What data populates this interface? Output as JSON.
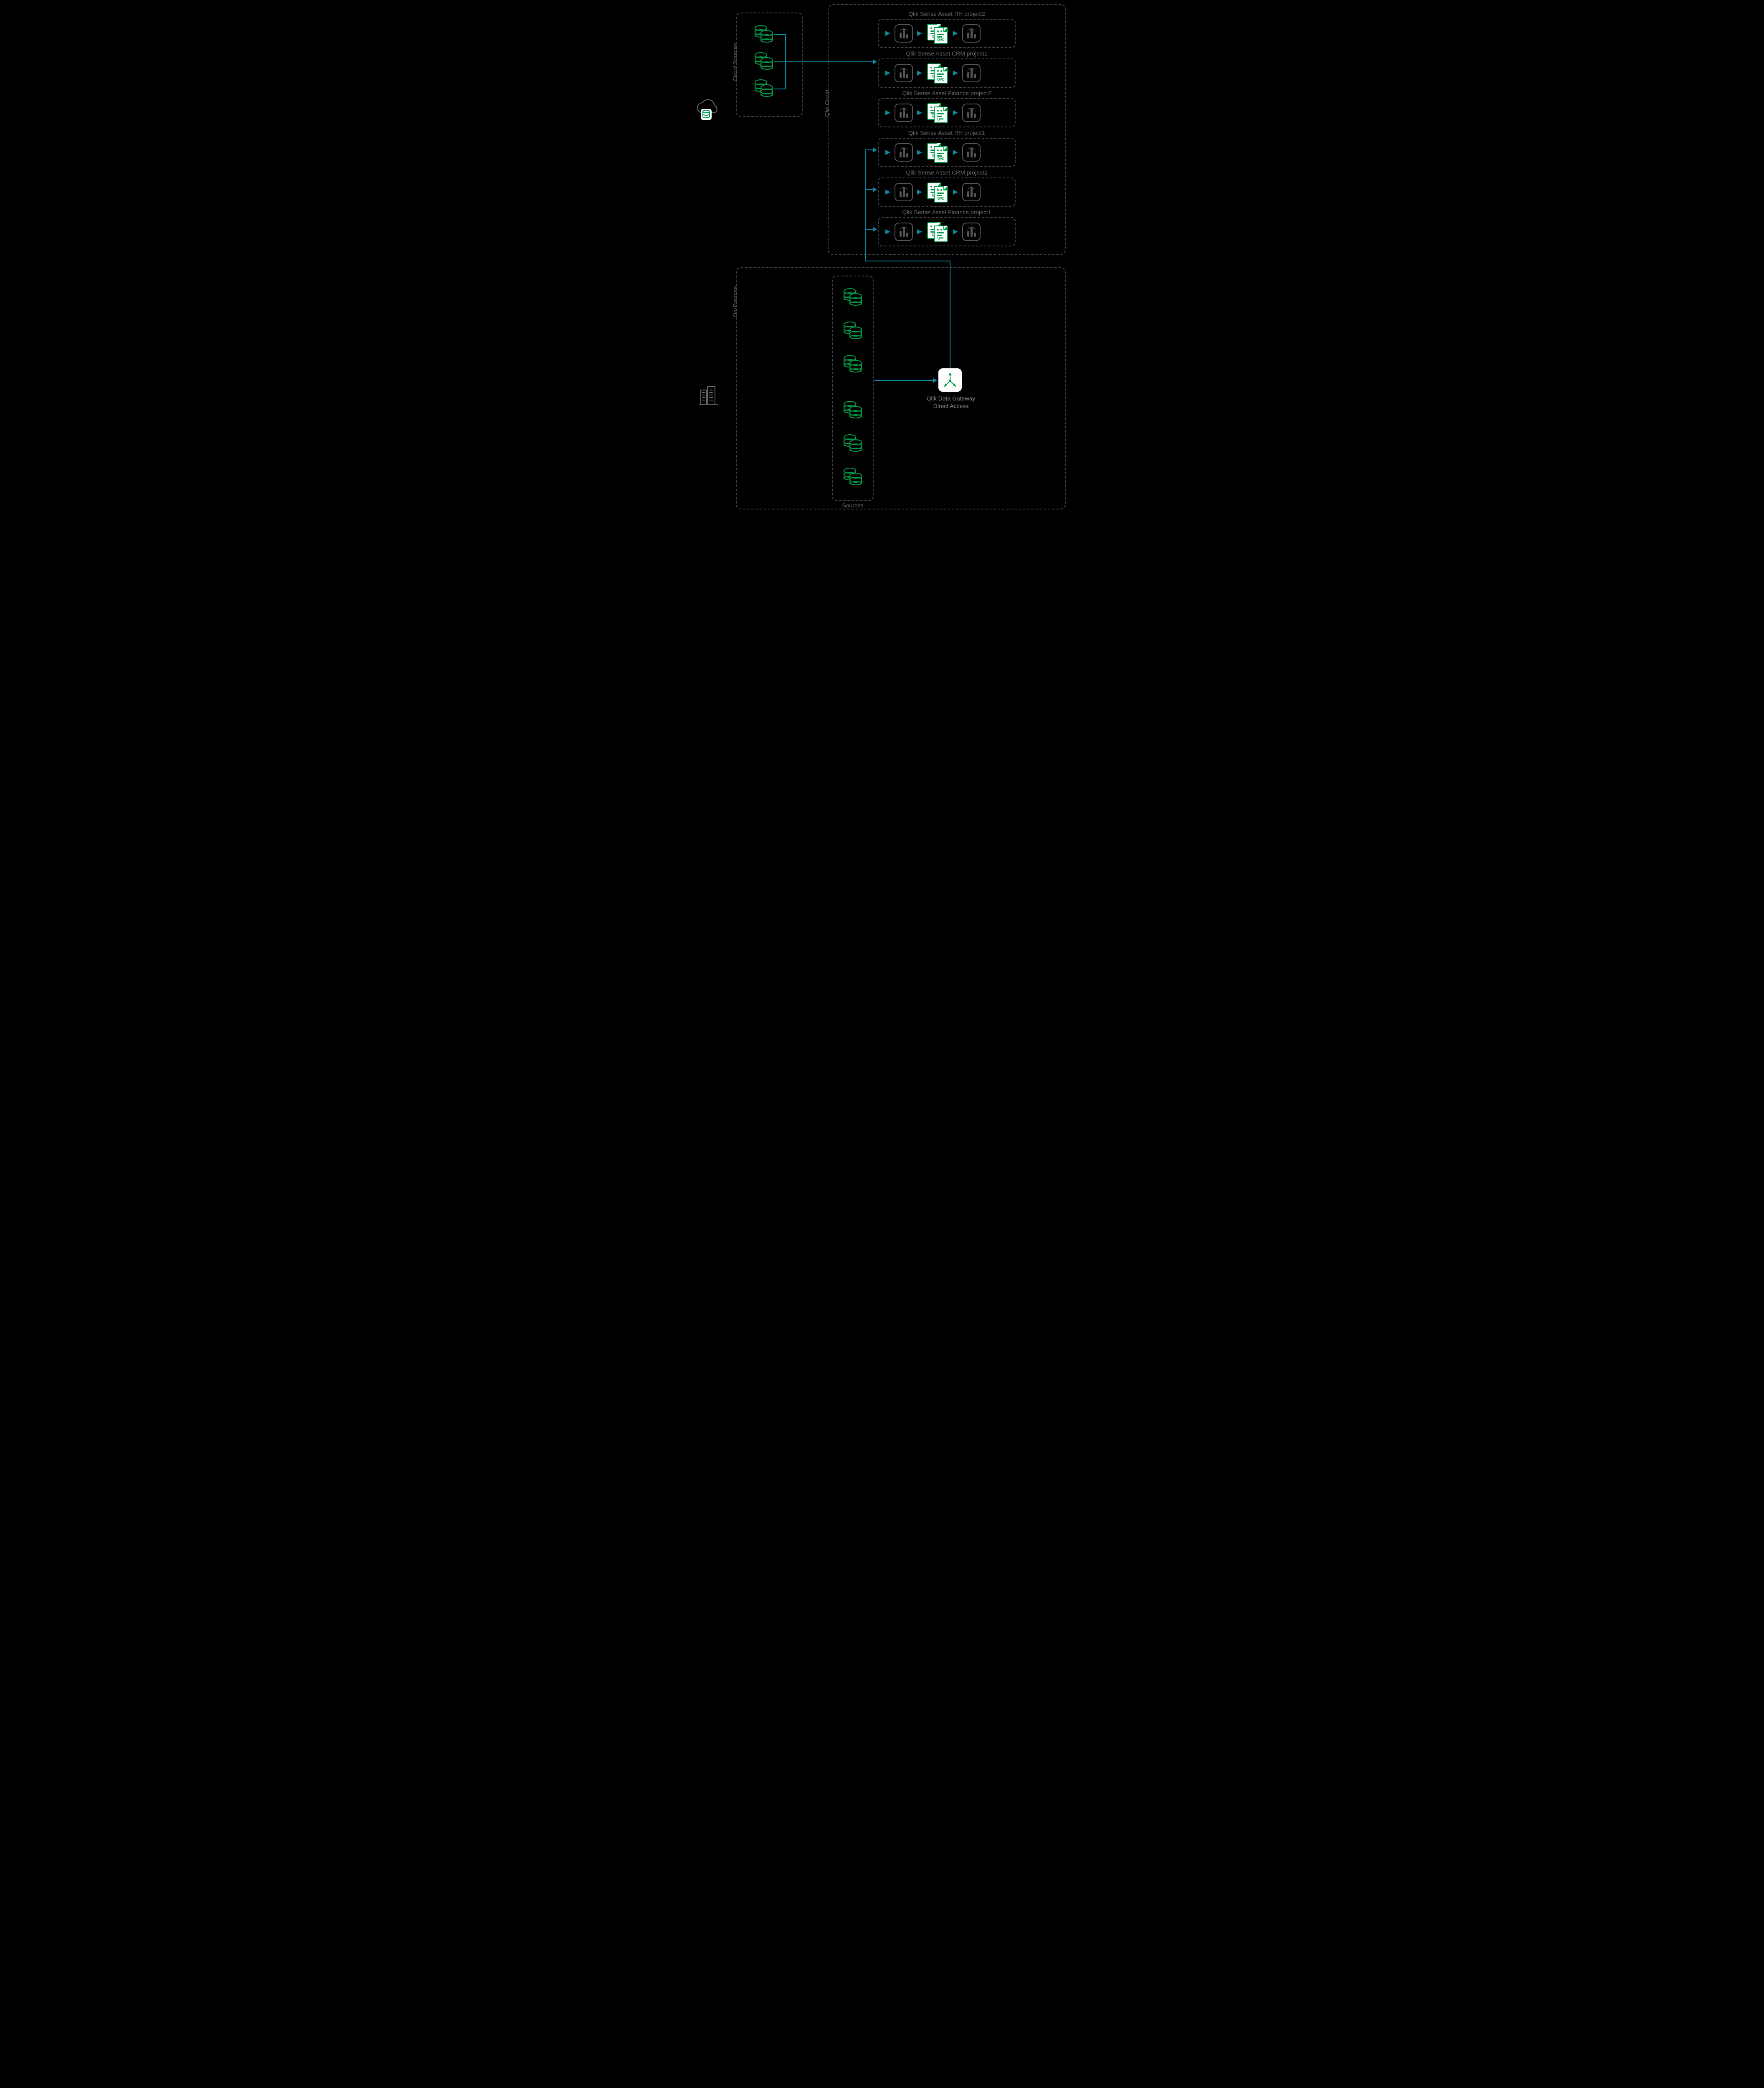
{
  "labels": {
    "cloud_sources": "Cloud Sources",
    "qlik_cloud": "Qlik Cloud",
    "on_premise": "On-Premise",
    "sources": "Sources",
    "gateway_l1": "Qlik Data Gateway",
    "gateway_l2": "Direct Access"
  },
  "assets": [
    {
      "title": "Qlik Sense Asset RH project2"
    },
    {
      "title": "Qlik Sense Asset CRM project1"
    },
    {
      "title": "Qlik Sense Asset Finance project2"
    },
    {
      "title": "Qlik Sense Asset RH project1"
    },
    {
      "title": "Qlik Sense Asset CRM project2"
    },
    {
      "title": "Qlik Sense Asset Finance project1"
    }
  ],
  "qvd": "QVD",
  "qv": "QV"
}
